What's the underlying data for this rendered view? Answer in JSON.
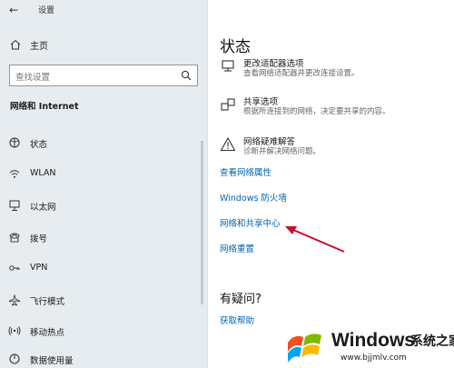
{
  "window": {
    "title": "设置"
  },
  "sidebar": {
    "home_label": "主页",
    "search_placeholder": "查找设置",
    "section_title": "网络和 Internet",
    "items": [
      {
        "label": "状态",
        "icon": "status-icon",
        "active": true
      },
      {
        "label": "WLAN",
        "icon": "wifi-icon"
      },
      {
        "label": "以太网",
        "icon": "ethernet-icon"
      },
      {
        "label": "拨号",
        "icon": "dialup-icon"
      },
      {
        "label": "VPN",
        "icon": "vpn-icon"
      },
      {
        "label": "飞行模式",
        "icon": "airplane-icon"
      },
      {
        "label": "移动热点",
        "icon": "hotspot-icon"
      },
      {
        "label": "数据使用量",
        "icon": "data-usage-icon"
      }
    ]
  },
  "main": {
    "title": "状态",
    "settings": [
      {
        "title": "更改适配器选项",
        "desc": "查看网络适配器并更改连接设置。",
        "icon": "adapter-icon"
      },
      {
        "title": "共享选项",
        "desc": "根据所连接到的网络，决定要共享的内容。",
        "icon": "sharing-icon"
      },
      {
        "title": "网络疑难解答",
        "desc": "诊断并解决网络问题。",
        "icon": "warning-icon"
      }
    ],
    "links": [
      "查看网络属性",
      "Windows 防火墙",
      "网络和共享中心",
      "网络重置"
    ],
    "question_title": "有疑问?",
    "help_link": "获取帮助"
  },
  "watermark": {
    "brand": "Windows",
    "cn": "系统之家",
    "url": "www.bjjmlv.com"
  },
  "colors": {
    "sidebar_bg": "#e6ecef",
    "link": "#0063b1",
    "arrow": "#c8102e"
  }
}
